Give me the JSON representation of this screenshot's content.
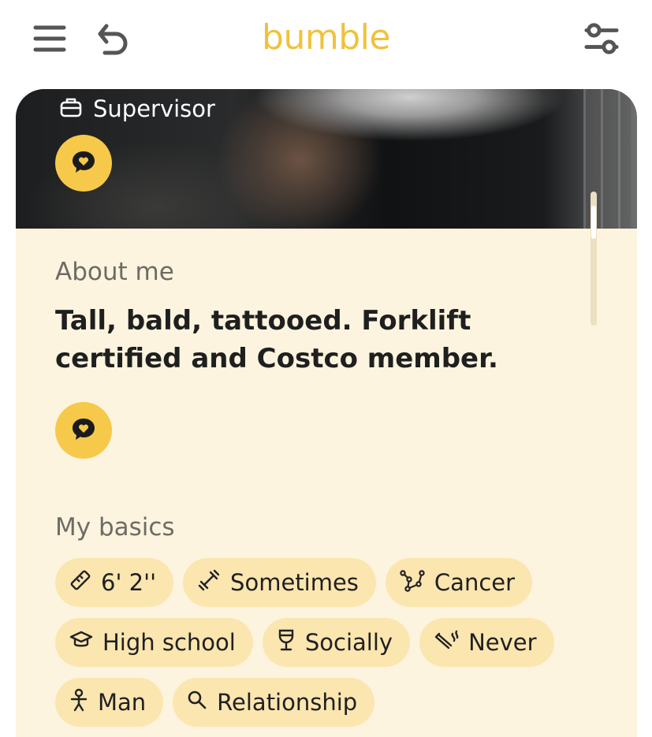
{
  "app": {
    "brand": "bumble",
    "brand_color": "#f0c23c"
  },
  "topbar": {
    "menu_icon": "hamburger-menu-icon",
    "back_icon": "undo-icon",
    "filter_icon": "filter-sliders-icon"
  },
  "profile": {
    "job_icon": "briefcase-icon",
    "job": "Supervisor",
    "about": {
      "title": "About me",
      "text": "Tall, bald, tattooed. Forklift certified and Costco member."
    },
    "basics": {
      "title": "My basics",
      "chips": [
        {
          "icon": "ruler-icon",
          "label": "6' 2''"
        },
        {
          "icon": "dumbbell-icon",
          "label": "Sometimes"
        },
        {
          "icon": "zodiac-constellation-icon",
          "label": "Cancer"
        },
        {
          "icon": "graduation-cap-icon",
          "label": "High school"
        },
        {
          "icon": "wine-glass-icon",
          "label": "Socially"
        },
        {
          "icon": "smoking-icon",
          "label": "Never"
        },
        {
          "icon": "person-icon",
          "label": "Man"
        },
        {
          "icon": "magnifier-icon",
          "label": "Relationship"
        }
      ]
    }
  },
  "colors": {
    "card_bg": "#fdf4df",
    "chip_bg": "#fbe6b0",
    "accent": "#f6c94a"
  }
}
